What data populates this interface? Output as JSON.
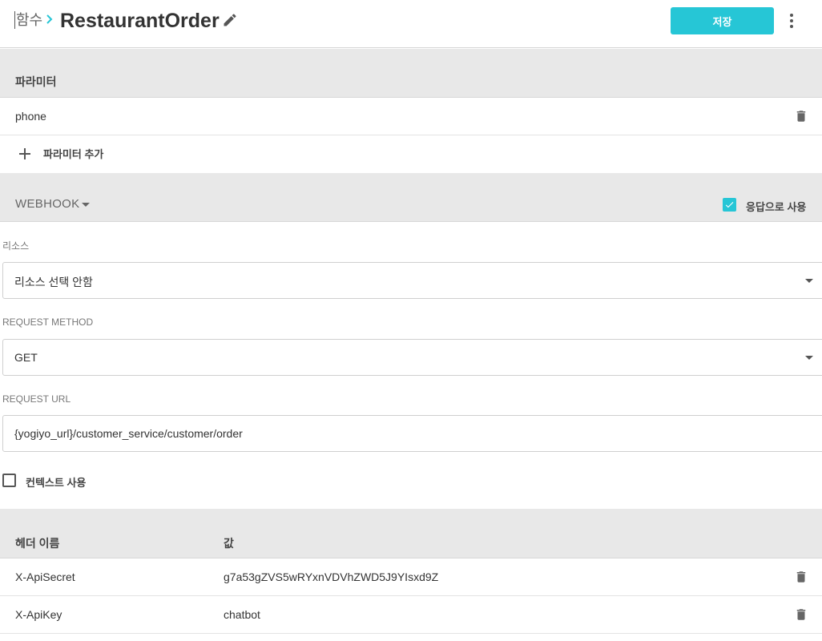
{
  "header": {
    "breadcrumb_root": "함수",
    "title": "RestaurantOrder",
    "save_label": "저장"
  },
  "parameters": {
    "section_label": "파라미터",
    "items": [
      {
        "name": "phone"
      }
    ],
    "add_label": "파라미터 추가"
  },
  "webhook": {
    "type_label": "WEBHOOK",
    "use_as_response_label": "응답으로 사용",
    "use_as_response_checked": true,
    "resource": {
      "label": "리소스",
      "value": "리소스 선택 안함"
    },
    "request_method": {
      "label": "REQUEST METHOD",
      "value": "GET"
    },
    "request_url": {
      "label": "REQUEST URL",
      "value": "{yogiyo_url}/customer_service/customer/order"
    },
    "use_context_label": "컨텍스트 사용",
    "use_context_checked": false
  },
  "headers_table": {
    "columns": [
      "헤더 이름",
      "값"
    ],
    "rows": [
      {
        "name": "X-ApiSecret",
        "value": "g7a53gZVS5wRYxnVDVhZWD5J9YIsxd9Z"
      },
      {
        "name": "X-ApiKey",
        "value": "chatbot"
      }
    ]
  },
  "colors": {
    "accent": "#26c6d6",
    "section_bg": "#e8e8e8"
  },
  "icons": {
    "breadcrumb_separator": "chevron-right-icon",
    "edit": "pencil-icon",
    "more": "more-vertical-icon",
    "delete": "trash-icon",
    "add": "plus-icon",
    "dropdown": "caret-down-icon",
    "checkbox": "check-icon"
  }
}
